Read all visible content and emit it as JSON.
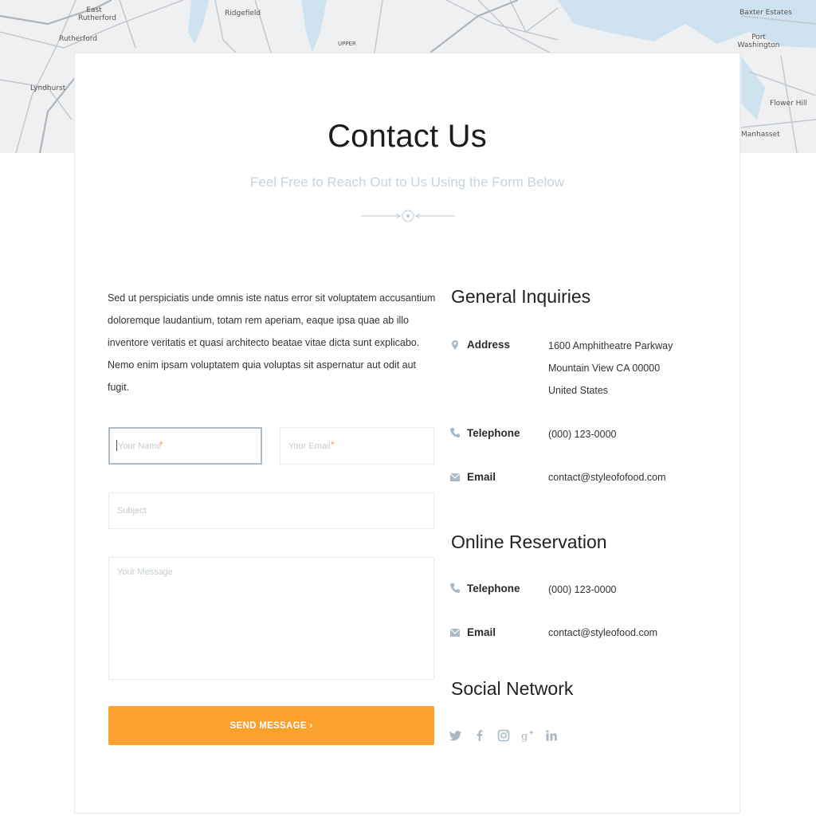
{
  "map": {
    "labels": [
      "East Rutherford",
      "Rutherford",
      "Lyndhurst",
      "Ridgefield",
      "Baxter Estates",
      "Port Washington",
      "Flower Hill",
      "Manhasset",
      "UPPER"
    ]
  },
  "header": {
    "title": "Contact Us",
    "subtitle": "Feel Free to Reach Out to Us Using the Form Below"
  },
  "intro_text": "Sed ut perspiciatis unde omnis iste natus error sit voluptatem accusantium doloremque laudantium, totam rem aperiam, eaque ipsa quae ab illo inventore veritatis et quasi architecto beatae vitae dicta sunt explicabo. Nemo enim ipsam voluptatem quia voluptas sit aspernatur aut odit aut fugit.",
  "form": {
    "name_placeholder": "Your Name",
    "email_placeholder": "Your Email",
    "subject_placeholder": "Subject",
    "message_placeholder": "Your Message",
    "required_marker": "*",
    "send_label": "SEND MESSAGE  ›"
  },
  "general": {
    "heading": "General Inquiries",
    "address_label": "Address",
    "address_line1": "1600 Amphitheatre Parkway",
    "address_line2": "Mountain View CA 00000",
    "address_line3": "United States",
    "telephone_label": "Telephone",
    "telephone_value": "(000) 123-0000",
    "email_label": "Email",
    "email_value": "contact@styleofofood.com"
  },
  "reservation": {
    "heading": "Online Reservation",
    "telephone_label": "Telephone",
    "telephone_value": "(000) 123-0000",
    "email_label": "Email",
    "email_value": "contact@styleofood.com"
  },
  "social": {
    "heading": "Social Network",
    "icons": [
      "twitter-icon",
      "facebook-icon",
      "instagram-icon",
      "google-plus-icon",
      "linkedin-icon"
    ]
  },
  "colors": {
    "accent": "#fba12e",
    "subtitle": "#c7d4de",
    "icon": "#a9b9c6"
  }
}
